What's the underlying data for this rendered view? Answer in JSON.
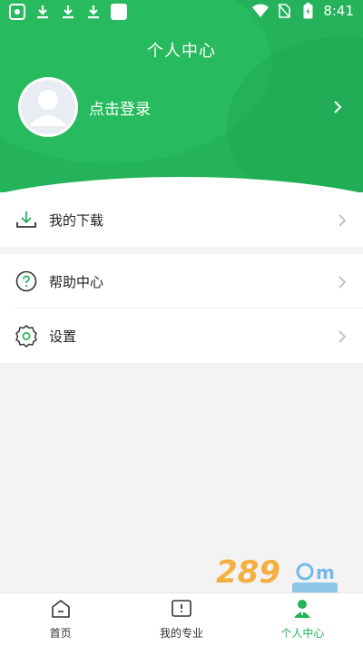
{
  "status_bar": {
    "time": "8:41",
    "icons": [
      "app-icon",
      "download-icon",
      "download-icon",
      "download-icon",
      "square-icon",
      "wifi-icon",
      "no-sim-icon",
      "battery-icon"
    ]
  },
  "header": {
    "title": "个人中心",
    "login_text": "点击登录"
  },
  "menu": [
    {
      "label": "我的下载",
      "icon": "download-icon"
    },
    {
      "label": "帮助中心",
      "icon": "help-icon"
    },
    {
      "label": "设置",
      "icon": "settings-icon"
    }
  ],
  "tabbar": {
    "tabs": [
      {
        "label": "首页",
        "icon": "home-icon"
      },
      {
        "label": "我的专业",
        "icon": "book-icon"
      },
      {
        "label": "个人中心",
        "icon": "person-icon",
        "active": true
      }
    ]
  },
  "colors": {
    "brand_green": "#24b35a",
    "chevron": "#bbbbbb"
  }
}
